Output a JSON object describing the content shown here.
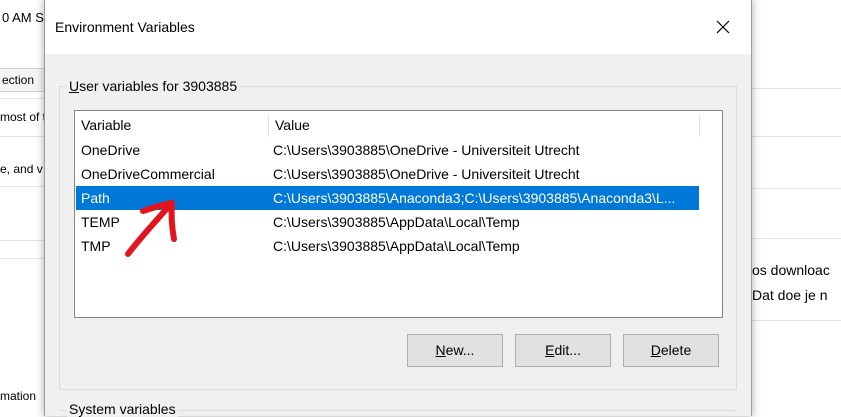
{
  "background": {
    "top_left_text": "0 AM S",
    "tab_label": "ection",
    "left_text_1": "most of t",
    "left_text_2": "e, and v",
    "left_text_3": "mation",
    "right_text_1": "os downloac",
    "right_text_2": "Dat doe je n"
  },
  "dialog": {
    "title": "Environment Variables",
    "close_icon": "close-icon",
    "user_group_label_prefix": "U",
    "user_group_label_rest": "ser variables for 3903885",
    "system_group_label": "System variables",
    "columns": [
      "Variable",
      "Value"
    ],
    "rows": [
      {
        "variable": "OneDrive",
        "value": "C:\\Users\\3903885\\OneDrive - Universiteit Utrecht",
        "selected": false
      },
      {
        "variable": "OneDriveCommercial",
        "value": "C:\\Users\\3903885\\OneDrive - Universiteit Utrecht",
        "selected": false
      },
      {
        "variable": "Path",
        "value": "C:\\Users\\3903885\\Anaconda3;C:\\Users\\3903885\\Anaconda3\\L...",
        "selected": true
      },
      {
        "variable": "TEMP",
        "value": "C:\\Users\\3903885\\AppData\\Local\\Temp",
        "selected": false
      },
      {
        "variable": "TMP",
        "value": "C:\\Users\\3903885\\AppData\\Local\\Temp",
        "selected": false
      }
    ],
    "buttons": {
      "new_ul": "N",
      "new_rest": "ew...",
      "edit_ul": "E",
      "edit_rest": "dit...",
      "delete_ul": "D",
      "delete_rest": "elete"
    }
  },
  "colors": {
    "selection": "#0078d7",
    "annotation_arrow": "#e3141d",
    "dialog_bg": "#f0f0f0"
  }
}
